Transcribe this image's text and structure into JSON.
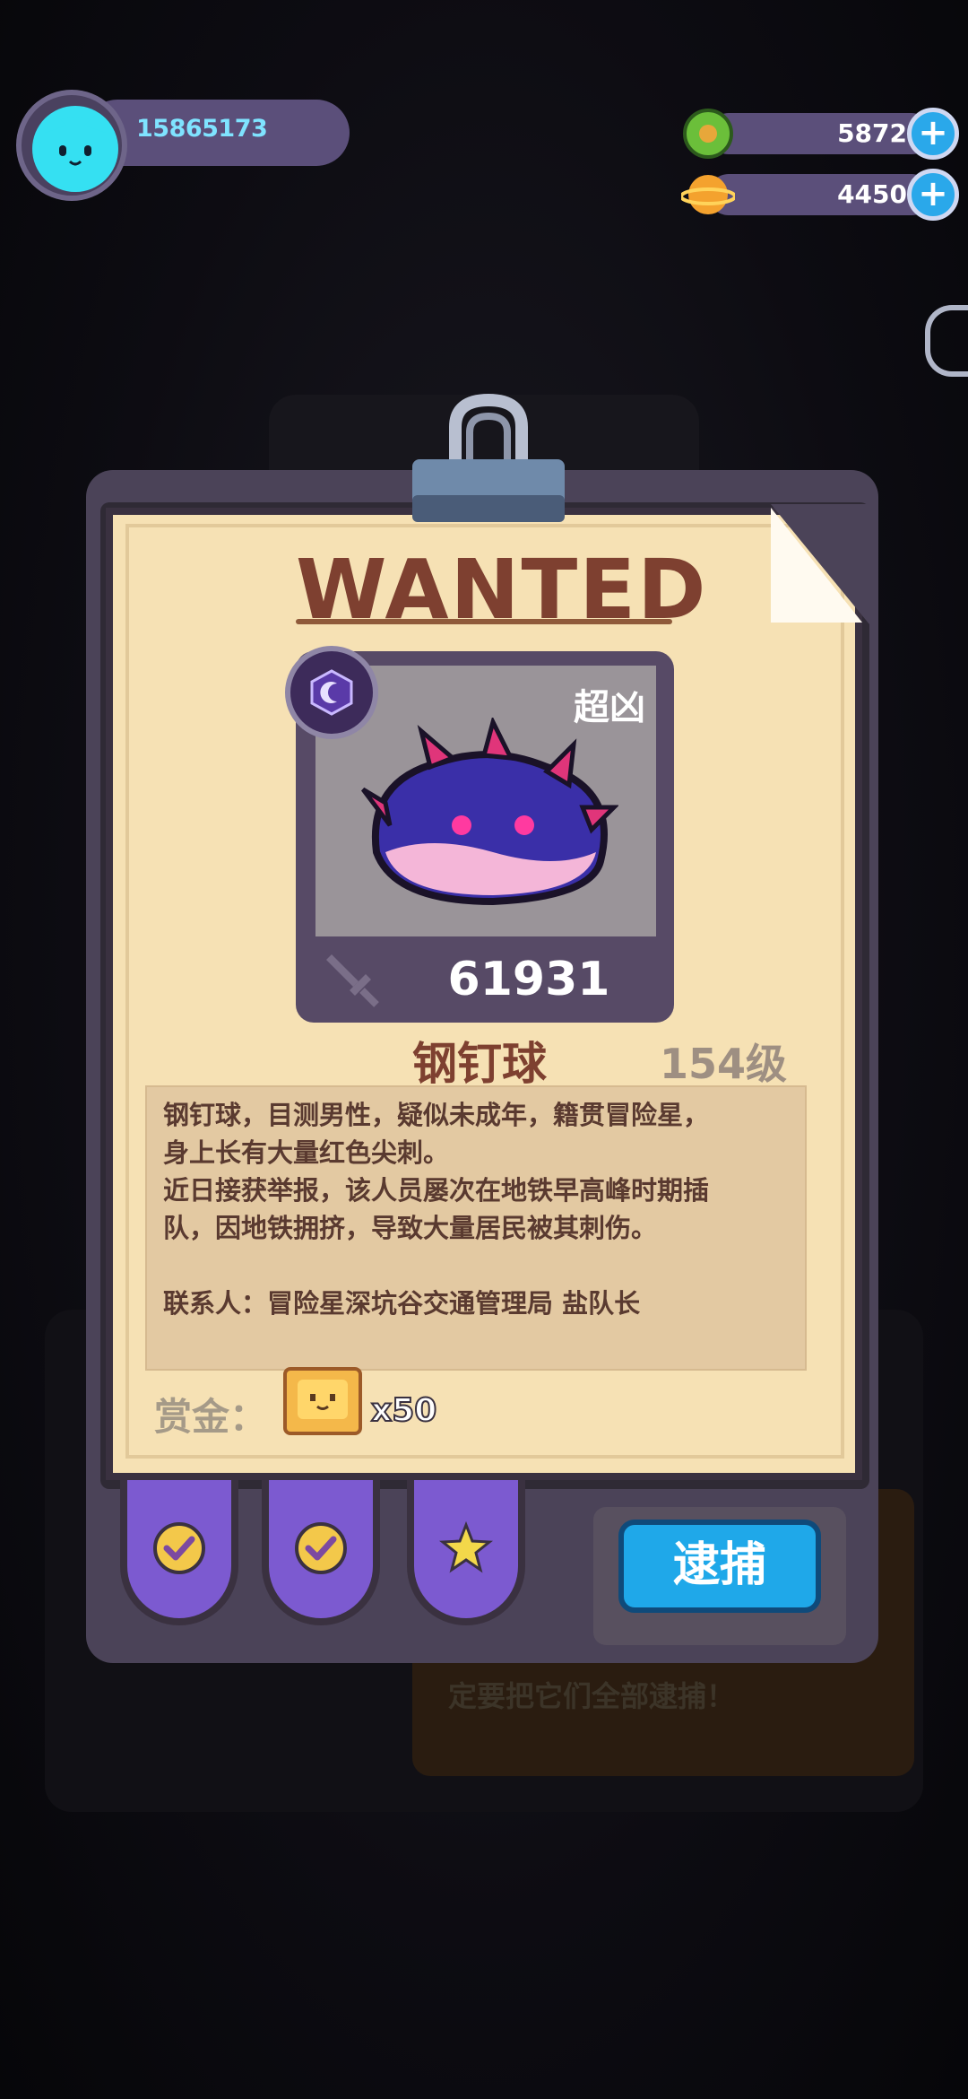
{
  "header": {
    "player_id": "15865173",
    "currencies": [
      {
        "name": "green-gem",
        "value": "5872",
        "color": "#6bbf3a"
      },
      {
        "name": "planet-coin",
        "value": "4450",
        "color": "#f4a22e"
      }
    ],
    "plus_label": "+"
  },
  "poster": {
    "title": "WANTED",
    "rarity_tag": "超凶",
    "power": "61931",
    "monster_name": "钢钉球",
    "level": "154级",
    "description": [
      "钢钉球，目测男性，疑似未成年，籍贯冒险星，",
      "身上长有大量红色尖刺。",
      "近日接获举报，该人员屡次在地铁早高峰时期插",
      "队，因地铁拥挤，导致大量居民被其刺伤。",
      "",
      "联系人：冒险星深坑谷交通管理局 盐队长"
    ],
    "reward_label": "赏金：",
    "reward_count": "x50"
  },
  "actions": {
    "tabs": [
      {
        "name": "check-icon"
      },
      {
        "name": "check-icon"
      },
      {
        "name": "star-icon"
      }
    ],
    "capture_label": "逮捕"
  },
  "background": {
    "hint_text": "定要把它们全部逮捕！"
  },
  "colors": {
    "accent": "#1fa8e9",
    "tab_purple": "#7c5ad0",
    "title_brown": "#7e4030"
  }
}
